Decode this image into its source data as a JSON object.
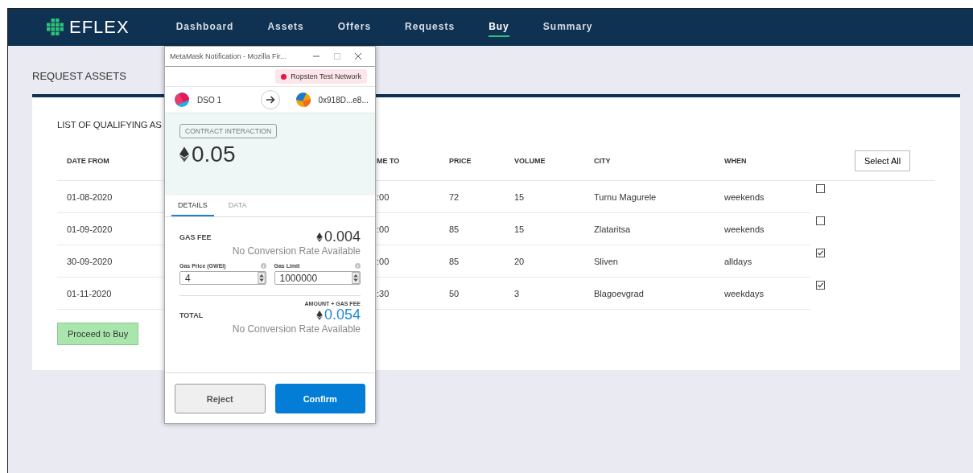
{
  "app": {
    "logo": "EFLEX",
    "nav": [
      {
        "label": "Dashboard",
        "selected": false
      },
      {
        "label": "Assets",
        "selected": false
      },
      {
        "label": "Offers",
        "selected": false
      },
      {
        "label": "Requests",
        "selected": false
      },
      {
        "label": "Buy",
        "selected": true
      },
      {
        "label": "Summary",
        "selected": false
      }
    ]
  },
  "page": {
    "title": "REQUEST ASSETS"
  },
  "card": {
    "title": "LIST OF QUALIFYING AS",
    "columns": [
      "DATE FROM",
      "ME TO",
      "PRICE",
      "VOLUME",
      "CITY",
      "WHEN"
    ],
    "select_all": "Select All",
    "rows": [
      {
        "date_from": "01-08-2020",
        "time_to": ":00",
        "price": "72",
        "volume": "15",
        "city": "Turnu Magurele",
        "when": "weekends",
        "checked": false
      },
      {
        "date_from": "01-09-2020",
        "time_to": ":00",
        "price": "85",
        "volume": "15",
        "city": "Zlataritsa",
        "when": "weekends",
        "checked": false
      },
      {
        "date_from": "30-09-2020",
        "time_to": ":00",
        "price": "85",
        "volume": "20",
        "city": "Sliven",
        "when": "alldays",
        "checked": true
      },
      {
        "date_from": "01-11-2020",
        "time_to": ":30",
        "price": "50",
        "volume": "3",
        "city": "Blagoevgrad",
        "when": "weekdays",
        "checked": true
      }
    ],
    "proceed": "Proceed to Buy"
  },
  "popup": {
    "title": "MetaMask Notification - Mozilla Fir...",
    "network": "Ropsten Test Network",
    "from": "DSO 1",
    "to": "0x918D...e8...",
    "badge": "CONTRACT INTERACTION",
    "amount": "0.05",
    "tabs": [
      {
        "label": "DETAILS",
        "selected": true
      },
      {
        "label": "DATA",
        "selected": false
      }
    ],
    "gas_fee_label": "GAS FEE",
    "gas_fee": "0.004",
    "gas_fee_note": "No Conversion Rate Available",
    "gas_price_label": "Gas Price (GWEI)",
    "gas_price": "4",
    "gas_limit_label": "Gas Limit",
    "gas_limit": "1000000",
    "total_caption": "AMOUNT + GAS FEE",
    "total_label": "TOTAL",
    "total": "0.054",
    "total_note": "No Conversion Rate Available",
    "buttons": [
      {
        "label": "Reject",
        "kind": "secondary"
      },
      {
        "label": "Confirm",
        "kind": "primary"
      }
    ]
  }
}
